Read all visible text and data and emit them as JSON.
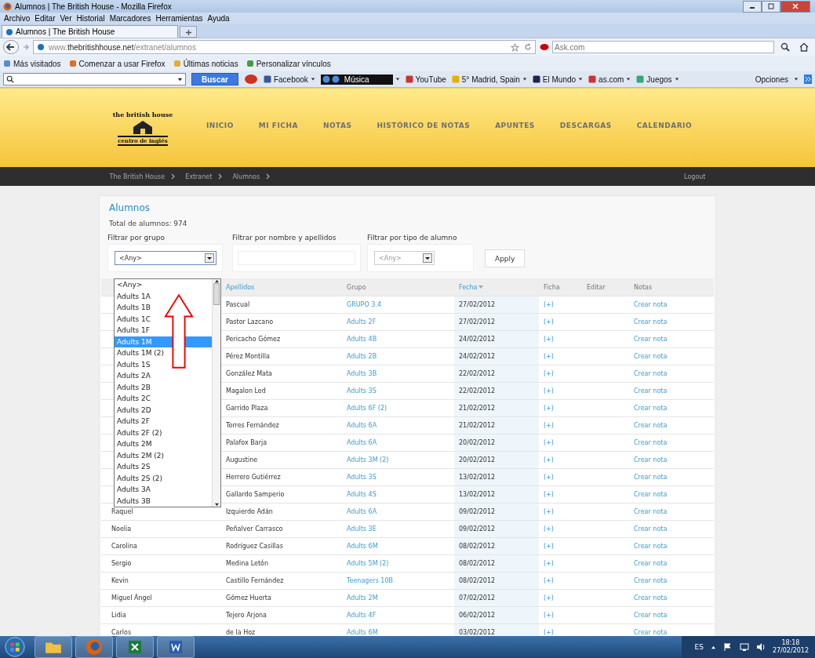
{
  "window": {
    "title": "Alumnos | The British House - Mozilla Firefox"
  },
  "menu_bar": [
    "Archivo",
    "Editar",
    "Ver",
    "Historial",
    "Marcadores",
    "Herramientas",
    "Ayuda"
  ],
  "tabs": [
    {
      "label": "Alumnos | The British House",
      "selected": true
    }
  ],
  "address_bar": {
    "url": "www.**thebritishhouse.net**/extranet/alumnos",
    "search_placeholder": "Ask.com"
  },
  "bookmarks": [
    "Más visitados",
    "Comenzar a usar Firefox",
    "Últimas noticias",
    "Personalizar vínculos"
  ],
  "search_toolbar": {
    "search_button": "Buscar",
    "items": [
      {
        "label": "Facebook",
        "has_menu": true
      },
      {
        "label": "Música",
        "has_menu": true,
        "kind": "player"
      },
      {
        "label": "YouTube",
        "has_menu": false
      },
      {
        "label": "5° Madrid, Spain",
        "has_menu": true
      },
      {
        "label": "El Mundo",
        "has_menu": true
      },
      {
        "label": "as.com",
        "has_menu": true
      },
      {
        "label": "Juegos",
        "has_menu": true
      }
    ],
    "options": "Opciones"
  },
  "site_header": {
    "logo_top": "the british house",
    "logo_bottom": "centro de inglés",
    "nav": [
      "INICIO",
      "MI FICHA",
      "NOTAS",
      "HISTÓRICO DE NOTAS",
      "APUNTES",
      "DESCARGAS",
      "CALENDARIO"
    ]
  },
  "breadcrumb": [
    "The British House",
    "Extranet",
    "Alumnos"
  ],
  "logout": "Logout",
  "page": {
    "title": "Alumnos",
    "total": "Total de alumnos: 974",
    "filters": {
      "group_label": "Filtrar por grupo",
      "group_value": "<Any>",
      "group_options": [
        {
          "label": "<Any>",
          "selected": false
        },
        {
          "label": "Adults 1A",
          "selected": false
        },
        {
          "label": "Adults 1B",
          "selected": false
        },
        {
          "label": "Adults 1C",
          "selected": false
        },
        {
          "label": "Adults 1F",
          "selected": false
        },
        {
          "label": "Adults 1M",
          "selected": true
        },
        {
          "label": "Adults 1M (2)",
          "selected": false
        },
        {
          "label": "Adults 1S",
          "selected": false
        },
        {
          "label": "Adults 2A",
          "selected": false
        },
        {
          "label": "Adults 2B",
          "selected": false
        },
        {
          "label": "Adults 2C",
          "selected": false
        },
        {
          "label": "Adults 2D",
          "selected": false
        },
        {
          "label": "Adults 2F",
          "selected": false
        },
        {
          "label": "Adults 2F (2)",
          "selected": false
        },
        {
          "label": "Adults 2M",
          "selected": false
        },
        {
          "label": "Adults 2M (2)",
          "selected": false
        },
        {
          "label": "Adults 2S",
          "selected": false
        },
        {
          "label": "Adults 2S (2)",
          "selected": false
        },
        {
          "label": "Adults 3A",
          "selected": false
        },
        {
          "label": "Adults 3B",
          "selected": false
        }
      ],
      "name_label": "Filtrar por nombre y apellidos",
      "type_label": "Filtrar por tipo de alumno",
      "type_value": "<Any>",
      "apply": "Apply"
    },
    "table": {
      "columns": [
        {
          "label": "Apellidos",
          "kind": "link",
          "sorted": false
        },
        {
          "label": "Grupo",
          "kind": "plain",
          "sorted": false
        },
        {
          "label": "Fecha",
          "kind": "link",
          "sorted": true
        },
        {
          "label": "Ficha",
          "kind": "plain",
          "sorted": false
        },
        {
          "label": "Editar",
          "kind": "plain",
          "sorted": false
        },
        {
          "label": "Notas",
          "kind": "plain",
          "sorted": false
        }
      ],
      "rows": [
        {
          "apellidos": "Pascual",
          "grupo": "GRUPO 3.4",
          "fecha": "27/02/2012",
          "ficha": "(+)",
          "notas": "Crear nota"
        },
        {
          "apellidos": "Pastor Lazcano",
          "grupo": "Adults 2F",
          "fecha": "27/02/2012",
          "ficha": "(+)",
          "notas": "Crear nota"
        },
        {
          "apellidos": "Pericacho Gómez",
          "grupo": "Adults 4B",
          "fecha": "24/02/2012",
          "ficha": "(+)",
          "notas": "Crear nota"
        },
        {
          "apellidos": "Pérez Montilla",
          "grupo": "Adults 2B",
          "fecha": "24/02/2012",
          "ficha": "(+)",
          "notas": "Crear nota"
        },
        {
          "apellidos": "González Mata",
          "grupo": "Adults 3B",
          "fecha": "22/02/2012",
          "ficha": "(+)",
          "notas": "Crear nota"
        },
        {
          "apellidos": "Magalon Led",
          "grupo": "Adults 3S",
          "fecha": "22/02/2012",
          "ficha": "(+)",
          "notas": "Crear nota"
        },
        {
          "apellidos": "Garrido Plaza",
          "grupo": "Adults 6F (2)",
          "fecha": "21/02/2012",
          "ficha": "(+)",
          "notas": "Crear nota"
        },
        {
          "apellidos": "Torres Fernández",
          "grupo": "Adults 6A",
          "fecha": "21/02/2012",
          "ficha": "(+)",
          "notas": "Crear nota"
        },
        {
          "apellidos": "Palafox Barja",
          "grupo": "Adults 6A",
          "fecha": "20/02/2012",
          "ficha": "(+)",
          "notas": "Crear nota"
        },
        {
          "apellidos": "Augustine",
          "grupo": "Adults 3M (2)",
          "fecha": "20/02/2012",
          "ficha": "(+)",
          "notas": "Crear nota"
        },
        {
          "apellidos": "Herrero Gutiérrez",
          "grupo": "Adults 3S",
          "fecha": "13/02/2012",
          "ficha": "(+)",
          "notas": "Crear nota"
        },
        {
          "apellidos": "Gallardo Samperio",
          "grupo": "Adults 4S",
          "fecha": "13/02/2012",
          "ficha": "(+)",
          "notas": "Crear nota"
        },
        {
          "nombre": "Raquel",
          "apellidos": "Izquierdo Adán",
          "grupo": "Adults 6A",
          "fecha": "09/02/2012",
          "ficha": "(+)",
          "notas": "Crear nota"
        },
        {
          "nombre": "Noelia",
          "apellidos": "Peñalver Carrasco",
          "grupo": "Adults 3E",
          "fecha": "09/02/2012",
          "ficha": "(+)",
          "notas": "Crear nota"
        },
        {
          "nombre": "Carolina",
          "apellidos": "Rodríguez Casillas",
          "grupo": "Adults 6M",
          "fecha": "08/02/2012",
          "ficha": "(+)",
          "notas": "Crear nota"
        },
        {
          "nombre": "Sergio",
          "apellidos": "Medina Letón",
          "grupo": "Adults 5M (2)",
          "fecha": "08/02/2012",
          "ficha": "(+)",
          "notas": "Crear nota"
        },
        {
          "nombre": "Kevin",
          "apellidos": "Castillo Fernández",
          "grupo": "Teenagers 10B",
          "fecha": "08/02/2012",
          "ficha": "(+)",
          "notas": "Crear nota"
        },
        {
          "nombre": "Miguel Ángel",
          "apellidos": "Gómez Huerta",
          "grupo": "Adults 2M",
          "fecha": "07/02/2012",
          "ficha": "(+)",
          "notas": "Crear nota"
        },
        {
          "nombre": "Lidia",
          "apellidos": "Tejero Arjona",
          "grupo": "Adults 4F",
          "fecha": "06/02/2012",
          "ficha": "(+)",
          "notas": "Crear nota"
        },
        {
          "nombre": "Carlos",
          "apellidos": "de la Hoz",
          "grupo": "Adults 6M",
          "fecha": "03/02/2012",
          "ficha": "(+)",
          "notas": "Crear nota"
        }
      ]
    }
  },
  "taskbar": {
    "language": "ES",
    "time": "18:18",
    "date": "27/02/2012"
  }
}
